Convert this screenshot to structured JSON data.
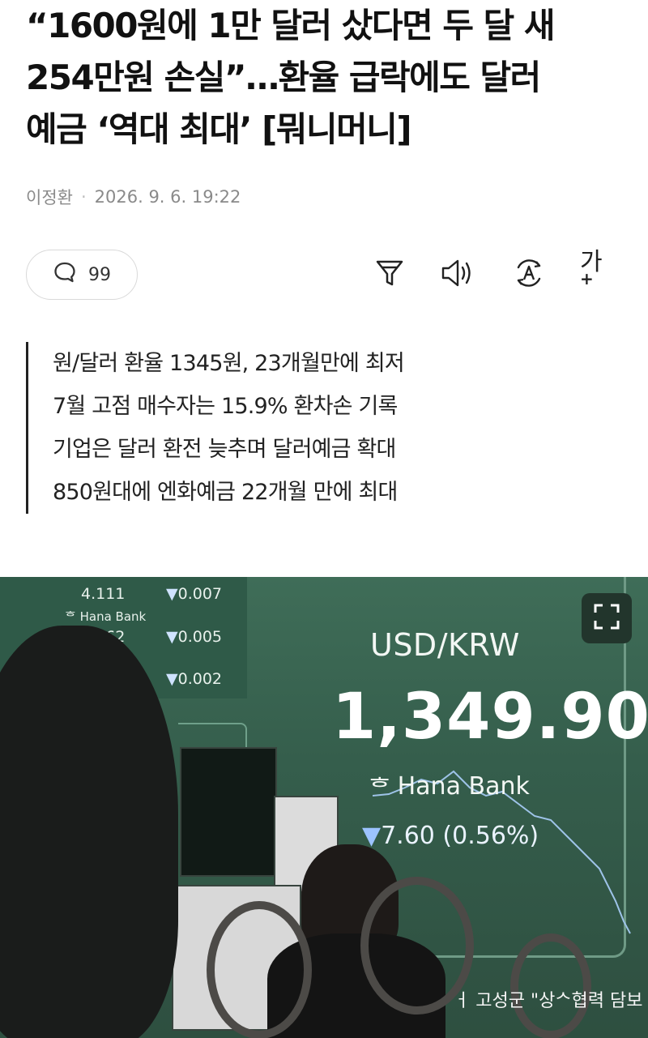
{
  "article": {
    "headline_line1": "“1600원에 1만 달러 샀다면 두 달 새",
    "headline_line2": "254만원 손실”…환율 급락에도 달러",
    "headline_line3": "예금 ‘역대 최대’ [뭐니머니]",
    "author": "이정환",
    "date": "2026. 9. 6. 19:22"
  },
  "toolbar": {
    "comment_count": "99",
    "font_size_label": "가",
    "font_size_plus": "+",
    "icons": [
      "comment-icon",
      "filter-icon",
      "speaker-icon",
      "translate-icon",
      "font-size-icon"
    ]
  },
  "summary": [
    "원/달러 환율 1345원, 23개월만에 최저",
    "7월 고점 매수자는 15.9% 환차손 기록",
    "기업은 달러 환전 늦추며 달러예금 확대",
    "850원대에 엔화예금 22개월 만에 최대"
  ],
  "photo": {
    "board_rows": [
      {
        "value": "4.111",
        "change": "0.007"
      },
      {
        "bank": "Hana Bank",
        "value": "4.362",
        "change": "0.005"
      },
      {
        "change": "0.002"
      }
    ],
    "pair": "USD/KRW",
    "rate": "1,349.90",
    "bank": "Hana Bank",
    "change": "7.60 (0.56%)",
    "caption_fragment": "ㅓ 고성군 \"상ᄉ협력 담보"
  }
}
